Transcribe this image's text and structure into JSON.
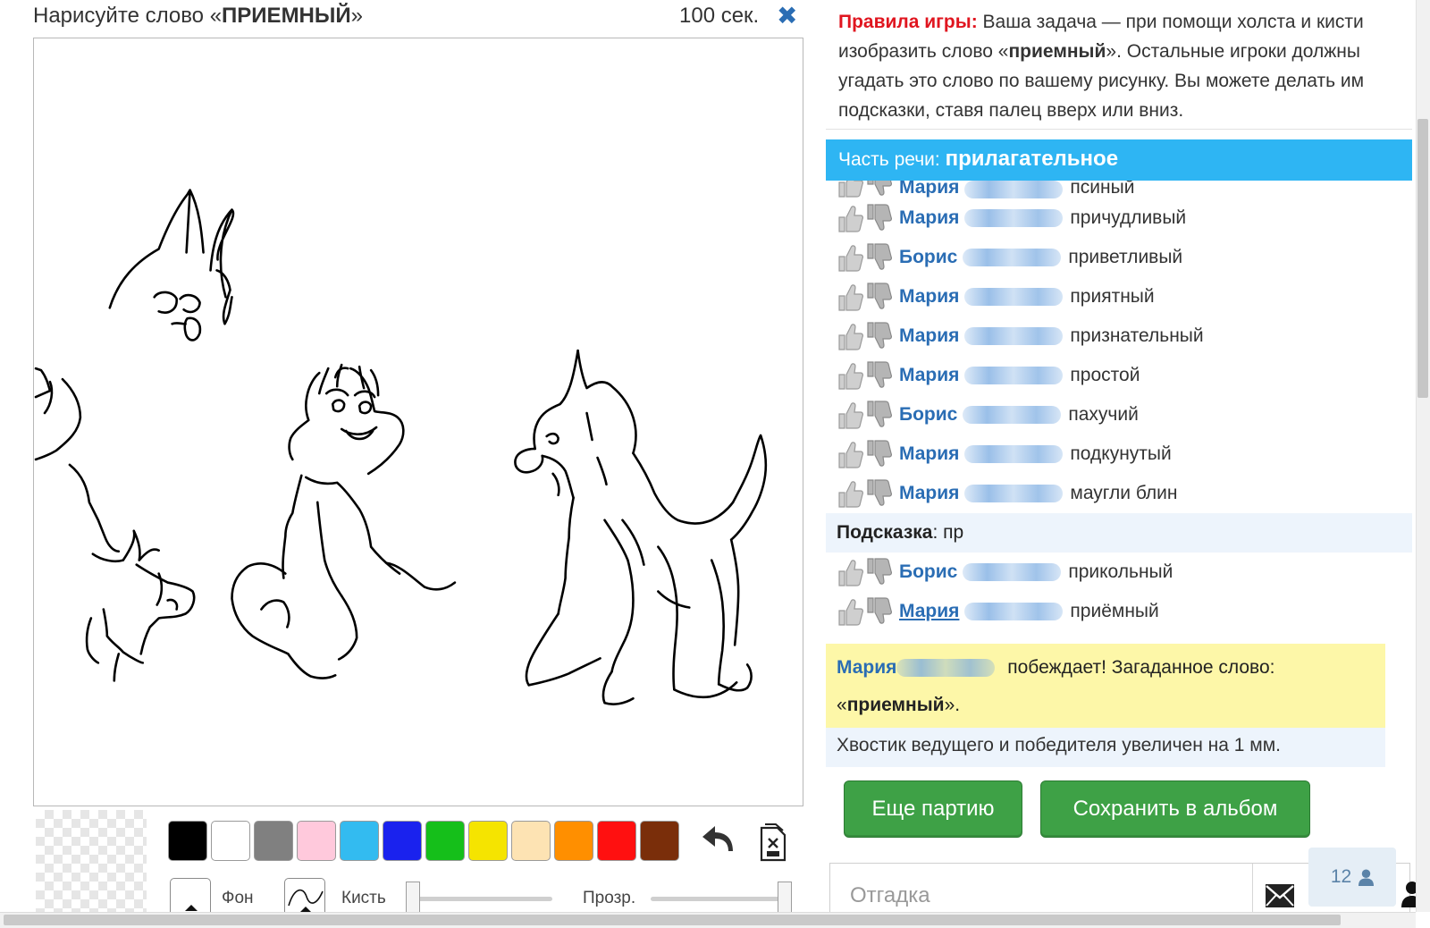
{
  "task": {
    "prefix": "Нарисуйте слово «",
    "word": "ПРИЕМНЫЙ",
    "suffix": "»",
    "timer": "100 сек.",
    "close_icon": "close-icon"
  },
  "palette": [
    "#000000",
    "#ffffff",
    "#808080",
    "#ffc9dc",
    "#33bbf0",
    "#1a22ee",
    "#15bf1a",
    "#f5e400",
    "#fde3b3",
    "#ff8f00",
    "#ff1010",
    "#7a2e0a"
  ],
  "tools": {
    "background_label": "Фон",
    "brush_label": "Кисть",
    "opacity_label": "Прозр.",
    "brush_size_fraction": 0.0,
    "opacity_fraction": 1.0,
    "undo_icon": "undo-icon",
    "clear_icon": "clear-canvas-icon"
  },
  "rules": {
    "label": "Правила игры:",
    "text_1": " Ваша задача — при помощи холста и кисти изобразить слово «",
    "word": "приемный",
    "text_2": "». Остальные игроки должны угадать это слово по вашему рисунку. Вы можете делать им подсказки, ставя палец вверх или вниз."
  },
  "part_of_speech": {
    "label": "Часть речи:",
    "value": "прилагательное"
  },
  "guesses": [
    {
      "name": "Мария",
      "word": "псиный",
      "cut": true
    },
    {
      "name": "Мария",
      "word": "причудливый"
    },
    {
      "name": "Борис",
      "word": "приветливый"
    },
    {
      "name": "Мария",
      "word": "приятный"
    },
    {
      "name": "Мария",
      "word": "признательный"
    },
    {
      "name": "Мария",
      "word": "простой"
    },
    {
      "name": "Борис",
      "word": "пахучий"
    },
    {
      "name": "Мария",
      "word": "подкунутый"
    },
    {
      "name": "Мария",
      "word": "маугли блин"
    }
  ],
  "hint": {
    "label": "Подсказка",
    "text": ": пр"
  },
  "guesses_after_hint": [
    {
      "name": "Борис",
      "word": "прикольный"
    },
    {
      "name": "Мария",
      "word": "приёмный",
      "link": true
    }
  ],
  "winner": {
    "name": "Мария",
    "text_1": " побеждает! Загаданное слово: «",
    "word": "приемный",
    "text_2": "»."
  },
  "bonus": "Хвостик ведущего и победителя увеличен на 1 мм.",
  "buttons": {
    "again": "Еще партию",
    "save": "Сохранить в альбом"
  },
  "answer": {
    "placeholder": "Отгадка",
    "send_icon": "envelope-icon"
  },
  "players": {
    "count": "12",
    "icon": "user-icon"
  },
  "colors": {
    "accent_blue": "#2eb5f3",
    "name_blue": "#2a6db4",
    "rules_red": "#e0151f",
    "winner_yellow": "#fdf7a8",
    "button_green": "#3ea146"
  }
}
